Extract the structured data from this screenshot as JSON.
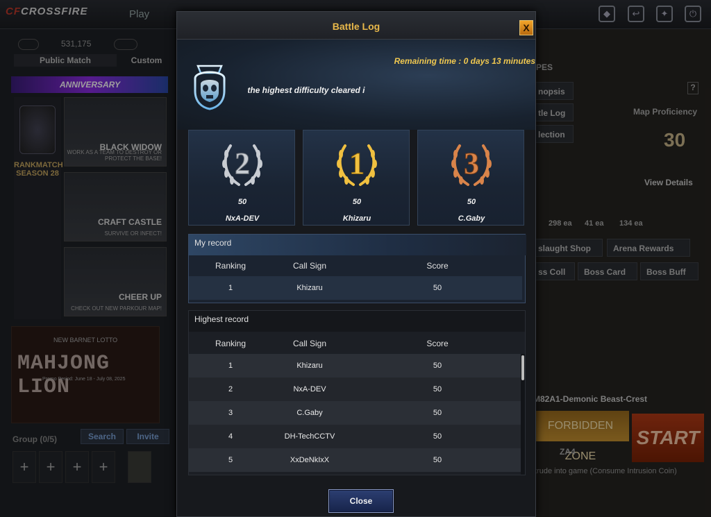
{
  "app": {
    "logo_prefix": "CF",
    "logo_name": "CROSSFIRE",
    "nav_play": "Play"
  },
  "left": {
    "currency": "531,175",
    "tabs": [
      "Public Match",
      "Custom"
    ],
    "banner": "ANNIVERSARY",
    "rank_title": "RANKMATCH",
    "rank_season": "SEASON 28",
    "modes": [
      {
        "title": "BLACK WIDOW",
        "subtitle": "WORK AS A TEAM TO DESTROY OR PROTECT THE BASE!"
      },
      {
        "title": "CRAFT CASTLE",
        "subtitle": "SURVIVE OR INFECT!"
      },
      {
        "title": "CHEER UP",
        "subtitle": "CHECK OUT NEW PARKOUR MAP!"
      }
    ],
    "mahjong_top": "NEW BARNET LOTTO",
    "mahjong_title": "MAHJONG LION",
    "mahjong_period": "Promo Period: June 18 - July 08, 2025",
    "group": "Group (0/5)",
    "search": "Search",
    "invite": "Invite",
    "slot_plus": "+"
  },
  "right": {
    "pes": "PES",
    "synopsis": "nopsis",
    "battle_log": "tle Log",
    "collection": "lection",
    "help": "?",
    "map_proficiency": "Map Proficiency",
    "proficiency_value": "30",
    "view_details": "View Details",
    "counts": [
      "298 ea",
      "41 ea",
      "134 ea"
    ],
    "onslaught_shop": "slaught Shop",
    "arena_rewards": "Arena Rewards",
    "boss_coll": "ss Coll",
    "boss_card": "Boss Card",
    "boss_buff": "Boss Buff",
    "weapon": "M82A1-Demonic Beast-Crest",
    "forbidden_zone": "FORBIDDEN ZONE",
    "zone_code": "ZA4",
    "start": "START",
    "intrude": "trude into game (Consume Intrusion Coin)"
  },
  "dialog": {
    "title": "Battle Log",
    "close_x": "X",
    "remaining": "Remaining time : 0 days 13 minutes",
    "difficulty": "s is the highest difficulty cleared i",
    "podium": [
      {
        "rank": "2",
        "score": "50",
        "name": "NxA-DEV",
        "tier": "silver"
      },
      {
        "rank": "1",
        "score": "50",
        "name": "Khizaru",
        "tier": "gold"
      },
      {
        "rank": "3",
        "score": "50",
        "name": "C.Gaby",
        "tier": "bronze"
      }
    ],
    "my_record": {
      "heading": "My record",
      "columns": [
        "Ranking",
        "Call Sign",
        "Score"
      ],
      "rows": [
        [
          "1",
          "Khizaru",
          "50"
        ]
      ]
    },
    "highest_record": {
      "heading": "Highest record",
      "columns": [
        "Ranking",
        "Call Sign",
        "Score"
      ],
      "rows": [
        [
          "1",
          "Khizaru",
          "50"
        ],
        [
          "2",
          "NxA-DEV",
          "50"
        ],
        [
          "3",
          "C.Gaby",
          "50"
        ],
        [
          "4",
          "DH-TechCCTV",
          "50"
        ],
        [
          "5",
          "XxDeNkIxX",
          "50"
        ]
      ]
    },
    "close_button": "Close"
  },
  "colors": {
    "accent_gold": "#e8b84a",
    "silver": "#c8ccd2",
    "gold": "#f0c040",
    "bronze": "#d9844a"
  }
}
